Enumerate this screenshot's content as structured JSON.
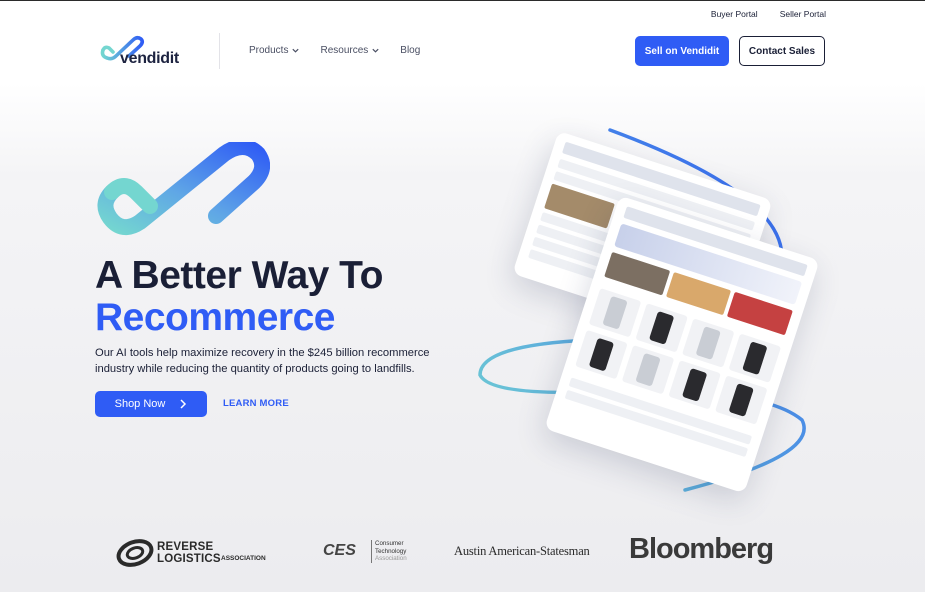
{
  "utility_nav": {
    "buyer_portal": "Buyer Portal",
    "seller_portal": "Seller Portal"
  },
  "header": {
    "logo_text": "vendidit",
    "nav": [
      {
        "label": "Products",
        "has_dropdown": true
      },
      {
        "label": "Resources",
        "has_dropdown": true
      },
      {
        "label": "Blog",
        "has_dropdown": false
      }
    ],
    "sell_button": "Sell on Vendidit",
    "contact_button": "Contact Sales"
  },
  "hero": {
    "title_line1": "A Better Way To",
    "title_line2": "Recommerce",
    "subtitle": "Our AI tools help maximize recovery in the $245 billion recommerce industry while reducing the quantity of products going to landfills.",
    "shop_button": "Shop Now",
    "learn_more": "LEARN MORE"
  },
  "press_logos": {
    "rla_name": "REVERSE LOGISTICS",
    "rla_sub": "ASSOCIATION",
    "ces_mark": "CES",
    "ces_line1": "Consumer",
    "ces_line2": "Technology",
    "ces_line3": "Association",
    "austin": "Austin American-Statesman",
    "bloomberg": "Bloomberg"
  },
  "colors": {
    "brand_blue": "#2f5cf5",
    "brand_teal": "#74d6d0",
    "text_dark": "#1a1f36"
  },
  "icons": {
    "logo": "check-swoosh-icon",
    "nav_dropdown": "chevron-down-icon",
    "shop_arrow": "chevron-right-icon"
  }
}
